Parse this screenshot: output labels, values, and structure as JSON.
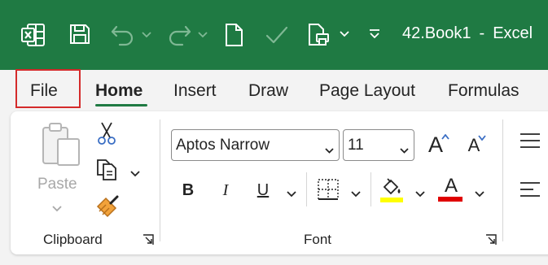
{
  "app": {
    "title_file": "42.Book1",
    "title_sep": "-",
    "title_app": "Excel"
  },
  "titlebar_icons": [
    "excel-logo-icon",
    "save-icon",
    "undo-icon",
    "redo-icon",
    "new-file-icon",
    "checkmark-icon",
    "print-preview-icon",
    "customize-toolbar-icon"
  ],
  "tabs": [
    {
      "label": "File",
      "active": false
    },
    {
      "label": "Home",
      "active": true
    },
    {
      "label": "Insert",
      "active": false
    },
    {
      "label": "Draw",
      "active": false
    },
    {
      "label": "Page Layout",
      "active": false
    },
    {
      "label": "Formulas",
      "active": false
    }
  ],
  "clipboard": {
    "paste_label": "Paste",
    "group_label": "Clipboard"
  },
  "font": {
    "font_name": "Aptos Narrow",
    "font_size": "11",
    "bold": "B",
    "italic": "I",
    "underline": "U",
    "increase_size": "A",
    "decrease_size": "A",
    "font_color_letter": "A",
    "group_label": "Font"
  },
  "colors": {
    "titlebar_bg": "#1f7a43",
    "fill_color": "#ffff00",
    "font_color": "#e00000",
    "highlight_border": "#d42a2a"
  }
}
